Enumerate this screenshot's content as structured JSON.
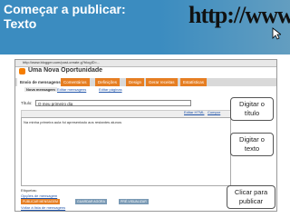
{
  "slide": {
    "title_line1": "Começar a publicar:",
    "title_line2": "Texto",
    "banner_text": "http://www"
  },
  "browser": {
    "url": "http://www.blogger.com/post-create.g?blogID=..."
  },
  "blogger": {
    "blog_title": "Uma Nova Oportunidade",
    "tabs": [
      {
        "label": "Envio de mensagens",
        "active": true
      },
      {
        "label": "Comentários",
        "active": false
      },
      {
        "label": "Definições",
        "active": false
      },
      {
        "label": "Design",
        "active": false
      },
      {
        "label": "Gerar receitas",
        "active": false
      },
      {
        "label": "Estatísticas",
        "active": false
      }
    ],
    "subtabs": [
      {
        "label": "Nova mensagem",
        "active": true
      },
      {
        "label": "Editar mensagens",
        "active": false
      },
      {
        "label": "Editar páginas",
        "active": false
      }
    ],
    "title_label": "Título:",
    "title_value": "O meu primeiro dia",
    "toolbar_links": [
      "Editar HTML",
      "Compor"
    ],
    "editor_text": "Na minha primeira aula foi apresentado aos restantes alunos",
    "labels_label": "Etiquetas:",
    "options_link": "Opções de mensagem",
    "buttons": [
      "PUBLICAR MENSAGEM",
      "GUARDAR AGORA",
      "PRÉ-VISUALIZAR"
    ],
    "back_link": "Voltar à lista de mensagens"
  },
  "callouts": {
    "title_hint": "Digitar o título",
    "text_hint": "Digitar o texto",
    "publish_hint": "Clicar para publicar"
  }
}
